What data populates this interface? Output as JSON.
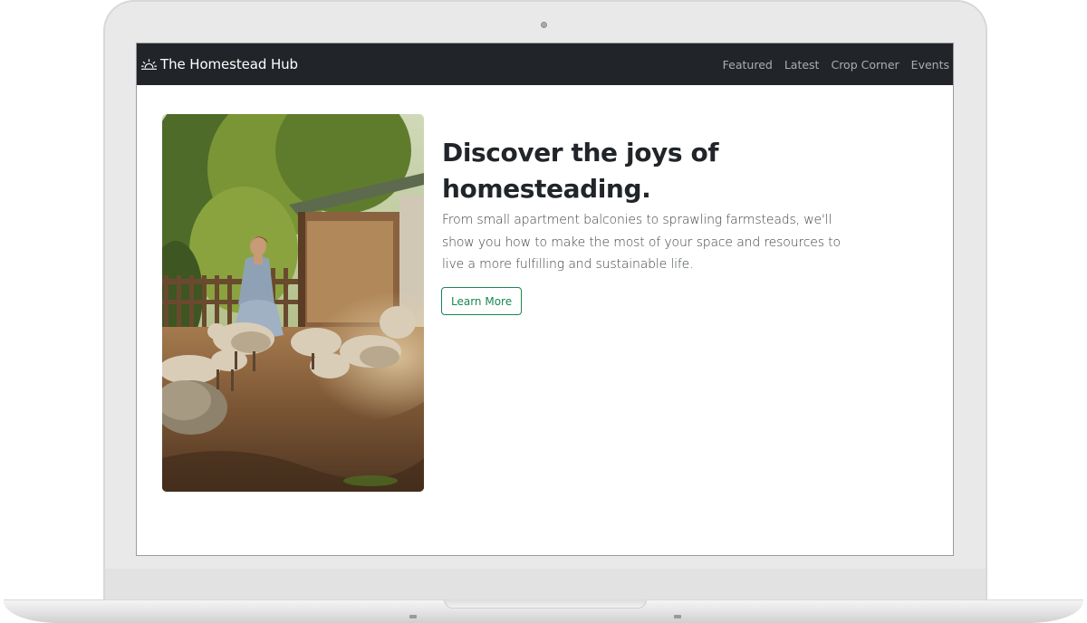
{
  "navbar": {
    "brand_icon": "sunrise-icon",
    "brand": "The Homestead Hub",
    "links": [
      "Featured",
      "Latest",
      "Crop Corner",
      "Events"
    ]
  },
  "hero": {
    "image_description": "woman-with-sheep-on-farm",
    "title": "Discover the joys of homesteading.",
    "lead": "From small apartment balconies to sprawling farmsteads, we'll show you how to make the most of your space and resources to live a more fulfilling and sustainable life.",
    "button_label": "Learn More"
  },
  "colors": {
    "navbar_bg": "#212529",
    "accent_success": "#198754",
    "text_dark": "#212529"
  }
}
